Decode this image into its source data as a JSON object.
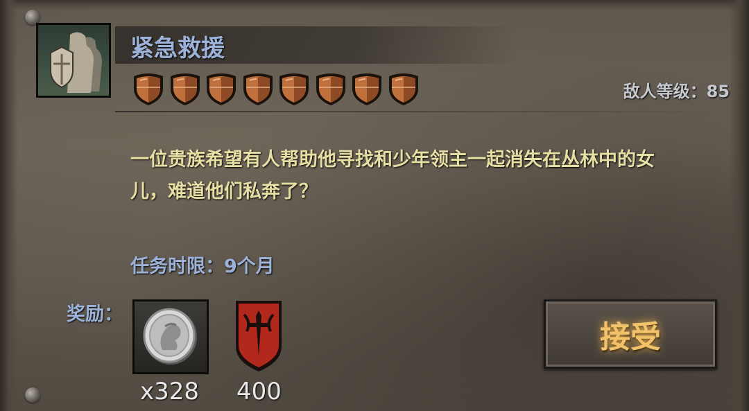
{
  "mission": {
    "title": "紧急救援",
    "difficulty_count": 8,
    "enemy_level_label": "敌人等级：85",
    "description_line1": "一位贵族希望有人帮助他寻找和少年领主一起消失在丛林中的女",
    "description_line2": "儿，难道他们私奔了？",
    "deadline": "任务时限：9个月"
  },
  "rewards": {
    "label": "奖励：",
    "items": [
      {
        "icon": "silver-coin-icon",
        "amount": "x328"
      },
      {
        "icon": "red-crest-banner-icon",
        "amount": "400"
      }
    ]
  },
  "actions": {
    "accept_label": "接受"
  },
  "colors": {
    "title_blue": "#9db2d8",
    "description_yellow": "#e6dfa4",
    "accept_gold": "#f2c26a",
    "shield_copper": "#c0703c"
  }
}
